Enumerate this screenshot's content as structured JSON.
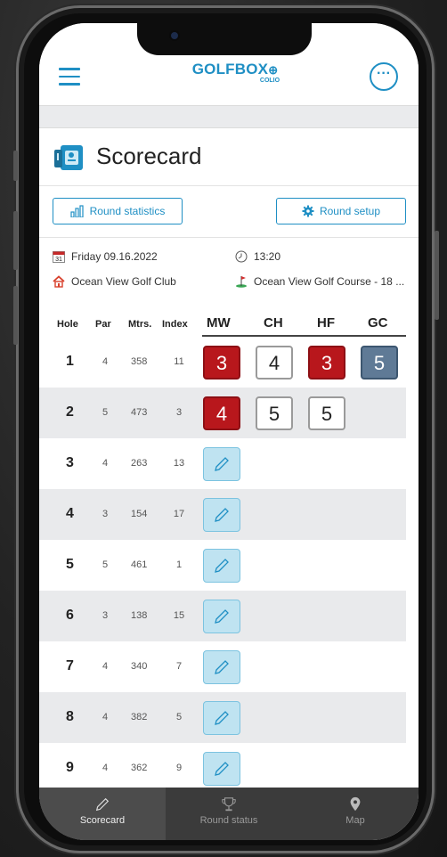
{
  "header": {
    "logo_main": "GOLFBOX",
    "logo_sub": "COLIO"
  },
  "page": {
    "title": "Scorecard"
  },
  "buttons": {
    "round_statistics": "Round statistics",
    "round_setup": "Round setup"
  },
  "info": {
    "date": "Friday 09.16.2022",
    "calendar_day": "31",
    "time": "13:20",
    "club": "Ocean View Golf Club",
    "course": "Ocean View Golf Course - 18 ..."
  },
  "table": {
    "headers": {
      "hole": "Hole",
      "par": "Par",
      "meters": "Mtrs.",
      "index": "Index"
    },
    "players": [
      "MW",
      "CH",
      "HF",
      "GC"
    ],
    "rows": [
      {
        "hole": "1",
        "par": "4",
        "meters": "358",
        "index": "11",
        "scores": [
          "3",
          "4",
          "3",
          "5"
        ]
      },
      {
        "hole": "2",
        "par": "5",
        "meters": "473",
        "index": "3",
        "scores": [
          "4",
          "5",
          "5"
        ]
      },
      {
        "hole": "3",
        "par": "4",
        "meters": "263",
        "index": "13"
      },
      {
        "hole": "4",
        "par": "3",
        "meters": "154",
        "index": "17"
      },
      {
        "hole": "5",
        "par": "5",
        "meters": "461",
        "index": "1"
      },
      {
        "hole": "6",
        "par": "3",
        "meters": "138",
        "index": "15"
      },
      {
        "hole": "7",
        "par": "4",
        "meters": "340",
        "index": "7"
      },
      {
        "hole": "8",
        "par": "4",
        "meters": "382",
        "index": "5"
      },
      {
        "hole": "9",
        "par": "4",
        "meters": "362",
        "index": "9"
      }
    ]
  },
  "bottom_nav": {
    "scorecard": "Scorecard",
    "round_status": "Round status",
    "map": "Map"
  },
  "colors": {
    "accent": "#1f8fc4",
    "score_red": "#b8171c",
    "score_blue": "#5f7a96",
    "edit_bg": "#bfe3f1"
  }
}
